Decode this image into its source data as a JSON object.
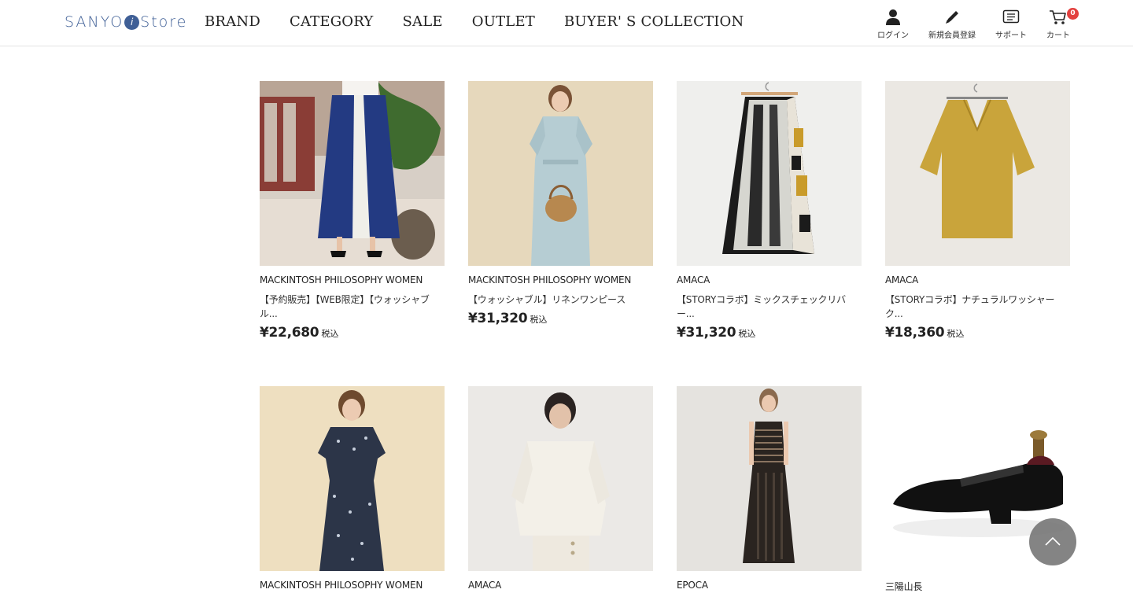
{
  "header": {
    "logo_text_left": "SANYO",
    "logo_mark": "i",
    "logo_text_right": "Store",
    "nav": [
      "BRAND",
      "CATEGORY",
      "SALE",
      "OUTLET",
      "BUYER' S COLLECTION"
    ],
    "utility": {
      "login": "ログイン",
      "register": "新規会員登録",
      "support": "サポート",
      "cart": "カート",
      "cart_count": "0"
    }
  },
  "products": [
    {
      "brand": "MACKINTOSH PHILOSOPHY WOMEN",
      "name": "【予約販売】【WEB限定】【ウォッシャブル...",
      "price": "¥22,680",
      "tax": "税込",
      "image": "blue-patterned-skirt-photo"
    },
    {
      "brand": "MACKINTOSH PHILOSOPHY WOMEN",
      "name": "【ウォッシャブル】リネンワンピース",
      "price": "¥31,320",
      "tax": "税込",
      "image": "light-blue-linen-dress-photo"
    },
    {
      "brand": "AMACA",
      "name": "【STORYコラボ】ミックスチェックリバー...",
      "price": "¥31,320",
      "tax": "税込",
      "image": "mixed-check-skirt-photo"
    },
    {
      "brand": "AMACA",
      "name": "【STORYコラボ】ナチュラルワッシャーク...",
      "price": "¥18,360",
      "tax": "税込",
      "image": "mustard-blouse-photo"
    },
    {
      "brand": "MACKINTOSH PHILOSOPHY WOMEN",
      "name": "",
      "price": "",
      "tax": "",
      "image": "floral-navy-dress-photo"
    },
    {
      "brand": "AMACA",
      "name": "",
      "price": "",
      "tax": "",
      "image": "white-jacket-set-photo"
    },
    {
      "brand": "EPOCA",
      "name": "",
      "price": "",
      "tax": "",
      "image": "black-lace-dress-photo"
    },
    {
      "brand": "三陽山長",
      "name": "",
      "price": "",
      "tax": "",
      "image": "black-oxford-shoe-photo"
    }
  ],
  "colors": {
    "logo": "#3f5f96",
    "badge": "#e3413f",
    "back_to_top": "#6e6e6e"
  }
}
